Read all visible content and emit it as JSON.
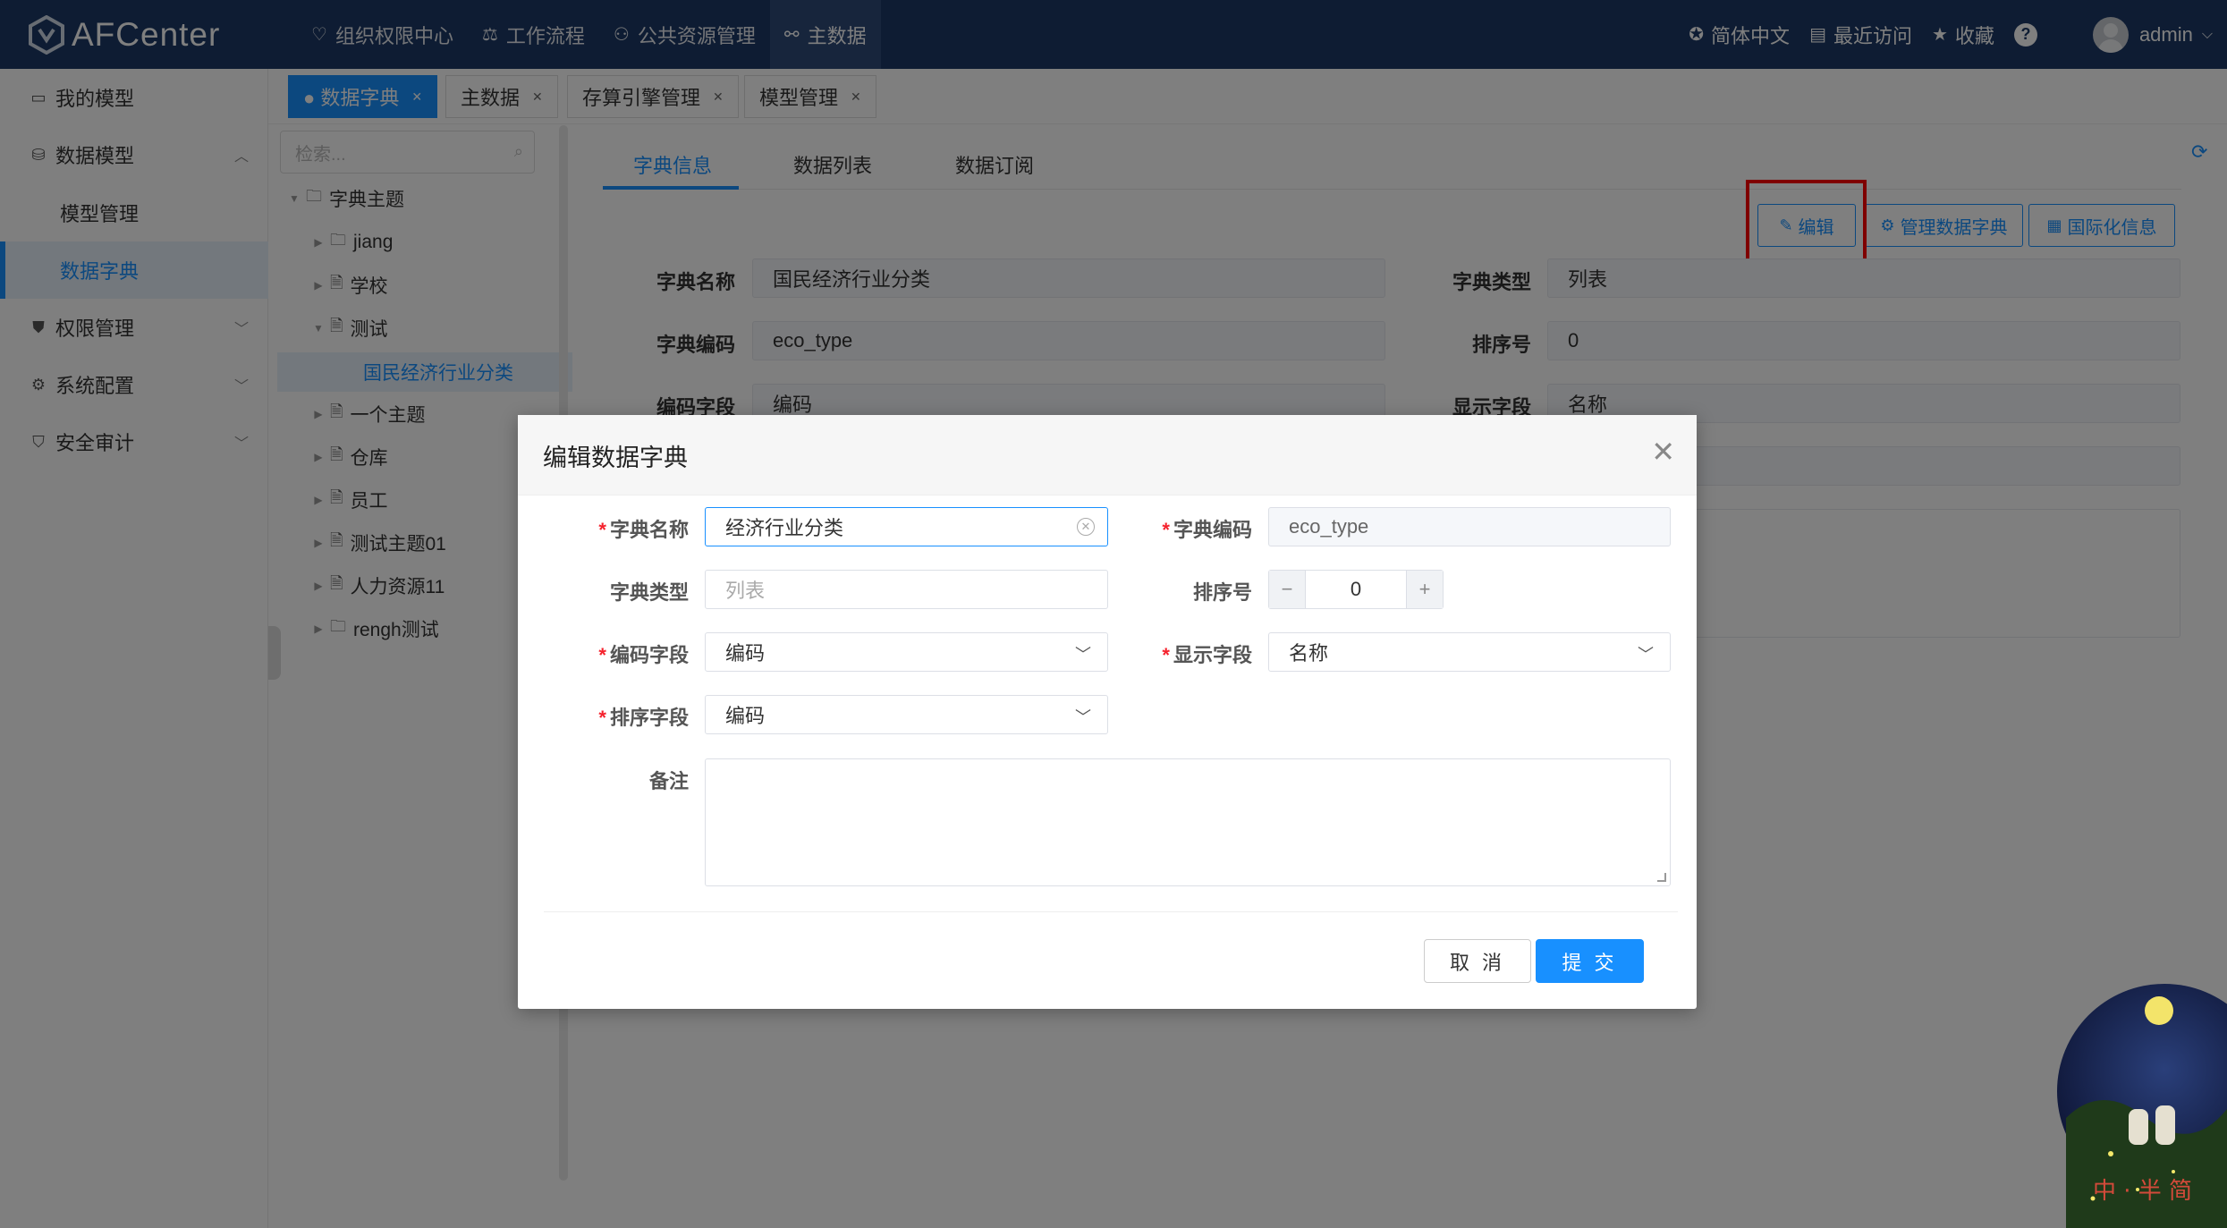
{
  "header": {
    "app_name": "AFCenter",
    "nav": [
      {
        "label": "组织权限中心",
        "icon": "heart-icon"
      },
      {
        "label": "工作流程",
        "icon": "scale-icon"
      },
      {
        "label": "公共资源管理",
        "icon": "users-icon"
      },
      {
        "label": "主数据",
        "icon": "link-icon"
      }
    ],
    "active_nav": "主数据",
    "language": "简体中文",
    "recent": "最近访问",
    "favorites": "收藏",
    "help": "?",
    "user": "admin"
  },
  "sidebar": {
    "items": [
      {
        "label": "我的模型"
      },
      {
        "label": "数据模型"
      },
      {
        "label": "模型管理"
      },
      {
        "label": "数据字典"
      },
      {
        "label": "权限管理"
      },
      {
        "label": "系统配置"
      },
      {
        "label": "安全审计"
      }
    ]
  },
  "page_tabs": [
    {
      "label": "● 数据字典"
    },
    {
      "label": "主数据"
    },
    {
      "label": "存算引擎管理"
    },
    {
      "label": "模型管理"
    }
  ],
  "tree": {
    "search_placeholder": "检索...",
    "nodes": [
      {
        "label": "字典主题"
      },
      {
        "label": "jiang"
      },
      {
        "label": "学校"
      },
      {
        "label": "测试"
      },
      {
        "label": "国民经济行业分类"
      },
      {
        "label": "一个主题"
      },
      {
        "label": "仓库"
      },
      {
        "label": "员工"
      },
      {
        "label": "测试主题01"
      },
      {
        "label": "人力资源11"
      },
      {
        "label": "rengh测试"
      }
    ]
  },
  "content": {
    "tabs": [
      "字典信息",
      "数据列表",
      "数据订阅"
    ],
    "buttons": {
      "edit": "编辑",
      "manage": "管理数据字典",
      "i18n": "国际化信息"
    },
    "fields": {
      "name_label": "字典名称",
      "name_value": "国民经济行业分类",
      "type_label": "字典类型",
      "type_value": "列表",
      "code_label": "字典编码",
      "code_value": "eco_type",
      "order_label": "排序号",
      "order_value": "0",
      "codefield_label": "编码字段",
      "codefield_value": "编码",
      "displayfield_label": "显示字段",
      "displayfield_value": "名称"
    }
  },
  "modal": {
    "title": "编辑数据字典",
    "name_label": "字典名称",
    "name_value": "经济行业分类",
    "code_label": "字典编码",
    "code_value": "eco_type",
    "type_label": "字典类型",
    "type_placeholder": "列表",
    "order_label": "排序号",
    "order_value": "0",
    "codefield_label": "编码字段",
    "codefield_value": "编码",
    "displayfield_label": "显示字段",
    "displayfield_value": "名称",
    "sortfield_label": "排序字段",
    "sortfield_value": "编码",
    "remark_label": "备注",
    "cancel": "取 消",
    "submit": "提 交"
  },
  "decoration": {
    "text": "中 · 半 简"
  },
  "colors": {
    "header_bg": "#1c3966",
    "accent": "#1890ff",
    "highlight": "#ff0000"
  }
}
